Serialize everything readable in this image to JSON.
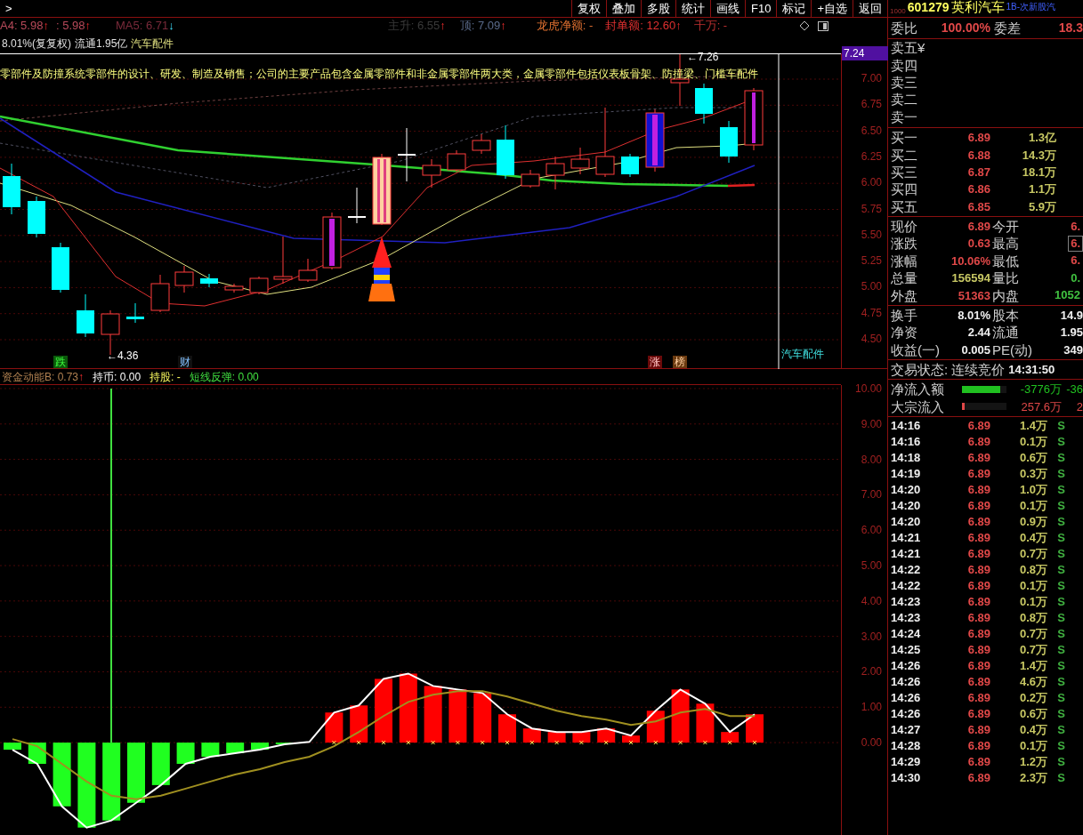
{
  "toolbar": {
    "nav": ">",
    "buttons": [
      "复权",
      "叠加",
      "多股",
      "统计",
      "画线",
      "F10",
      "标记",
      "+自选",
      "返回"
    ]
  },
  "ma_line": [
    {
      "text": "A4: 5.98",
      "arrow": "↑",
      "falling": false,
      "color": "#b84a5a"
    },
    {
      "text": ": 5.98",
      "arrow": "↑",
      "falling": false,
      "color": "#b84a5a"
    },
    {
      "text": "MA5: 6.71",
      "arrow": "↓",
      "falling": true,
      "color": "#7a2a3a"
    },
    {
      "text": "主升: 6.55",
      "arrow": "↑",
      "falling": false,
      "color": "#3a3a3a"
    },
    {
      "text": "顶: 7.09",
      "arrow": "↑",
      "falling": false,
      "color": "#5a6a8a"
    },
    {
      "text": "龙虎净额: -",
      "color": "#e07030"
    },
    {
      "text": "封单额: 12.60",
      "arrow": "↑",
      "falling": false,
      "color": "#e03030"
    },
    {
      "text": "千万: -",
      "color": "#c03030"
    }
  ],
  "info_line": {
    "turnover": "8.01%(复复权)",
    "float": "流通1.95亿",
    "sector": "汽车配件"
  },
  "main_chart": {
    "crosshair_price": "7.24",
    "high_label": "←7.26",
    "low_label": "←4.36",
    "description": "零部件及防撞系统零部件的设计、研发、制造及销售；公司的主要产品包含金属零部件和非金属零部件两大类，金属零部件包括仪表板骨架、防撞梁、门槛车配件",
    "yticks": [
      "7.00",
      "6.75",
      "6.50",
      "6.25",
      "6.00",
      "5.75",
      "5.50",
      "5.25",
      "5.00",
      "4.75",
      "4.50"
    ],
    "markers": [
      {
        "text": "跌",
        "kind": "down"
      },
      {
        "text": "财",
        "kind": "finance"
      },
      {
        "text": "涨",
        "kind": "up"
      },
      {
        "text": "榜",
        "kind": "list"
      }
    ],
    "sector_label": "汽车配件"
  },
  "indicator": {
    "labels": [
      {
        "text": ": 0.73",
        "arrow": "↑",
        "kind": "main"
      },
      {
        "text": "持币: 0.00",
        "kind": "cash"
      },
      {
        "text": "持股: -",
        "kind": "stock"
      },
      {
        "text": "短线反弹: 0.00",
        "kind": "rebound"
      }
    ],
    "chart_data": {
      "type": "bar",
      "stacked": true,
      "grid": true,
      "ylim": [
        -2.61,
        10.1
      ],
      "categories": [
        null,
        null,
        null,
        null,
        null,
        null,
        null,
        null,
        null,
        null,
        null,
        null,
        null,
        null,
        null,
        null,
        null,
        null,
        null,
        null,
        null,
        null,
        null,
        null,
        null,
        null,
        null,
        null,
        null,
        null,
        null
      ],
      "yticks": [
        {
          "value": 10,
          "label": "10.00"
        },
        {
          "value": 9,
          "label": "9.00"
        },
        {
          "value": 8,
          "label": "8.00"
        },
        {
          "value": 7,
          "label": "7.00"
        },
        {
          "value": 6,
          "label": "6.00"
        },
        {
          "value": 5,
          "label": "5.00"
        },
        {
          "value": 4,
          "label": "4.00"
        },
        {
          "value": 3,
          "label": "3.00"
        },
        {
          "value": 2,
          "label": "2.00"
        },
        {
          "value": 1,
          "label": "1.00"
        },
        {
          "value": 0,
          "label": "0.00"
        }
      ],
      "series": [
        {
          "name": "资金动能B",
          "type": "bar",
          "color": "#ff0000",
          "values": [
            null,
            null,
            null,
            null,
            null,
            null,
            null,
            null,
            null,
            null,
            null,
            null,
            null,
            0.85,
            1.05,
            1.8,
            1.95,
            1.6,
            1.5,
            1.4,
            0.8,
            0.4,
            0.3,
            0.3,
            0.4,
            0.2,
            0.9,
            1.5,
            1.1,
            0.3,
            0.8
          ]
        },
        {
          "type": "bar",
          "color": "#20ff20",
          "values": [
            -0.2,
            -0.6,
            -1.8,
            -2.4,
            -2.2,
            -1.7,
            -1.2,
            -0.6,
            -0.4,
            -0.3,
            -0.2,
            -0.05,
            null,
            null,
            null,
            null,
            null,
            null,
            null,
            null,
            null,
            null,
            null,
            null,
            null,
            null,
            null,
            null,
            null,
            null,
            null
          ]
        },
        {
          "type": "scatter",
          "color": "#ffff60",
          "values": [
            null,
            null,
            null,
            null,
            null,
            null,
            null,
            null,
            null,
            null,
            null,
            null,
            null,
            0,
            0,
            0,
            0,
            0,
            0,
            0,
            0,
            0,
            0,
            0,
            0,
            0,
            0,
            0,
            0,
            0,
            0
          ]
        },
        {
          "type": "line",
          "color": "#ffffff",
          "values": [
            -0.2,
            -0.6,
            -1.8,
            -2.4,
            -2.2,
            -1.7,
            -1.2,
            -0.6,
            -0.4,
            -0.3,
            -0.2,
            -0.05,
            0.02,
            0.85,
            1.05,
            1.8,
            1.95,
            1.6,
            1.5,
            1.4,
            0.8,
            0.4,
            0.3,
            0.3,
            0.4,
            0.2,
            0.9,
            1.5,
            1.1,
            0.3,
            0.8
          ]
        },
        {
          "type": "line",
          "color": "#a09020",
          "values": [
            0.1,
            -0.1,
            -0.6,
            -1.1,
            -1.5,
            -1.6,
            -1.5,
            -1.3,
            -1.1,
            -0.9,
            -0.75,
            -0.55,
            -0.4,
            -0.1,
            0.3,
            0.75,
            1.15,
            1.35,
            1.45,
            1.45,
            1.3,
            1.1,
            0.9,
            0.75,
            0.65,
            0.5,
            0.6,
            0.85,
            0.95,
            0.75,
            0.75
          ]
        }
      ]
    }
  },
  "quote_panel": {
    "code_prefix": "1000",
    "code": "601279",
    "name": "英利汽车",
    "tag": "1B-次新股汽",
    "ratio": {
      "label": "委比",
      "value": "100.00%",
      "label2": "委差",
      "value2": "18.3"
    },
    "asks": [
      {
        "label": "卖五",
        "extra": "¥"
      },
      {
        "label": "卖四"
      },
      {
        "label": "卖三"
      },
      {
        "label": "卖二"
      },
      {
        "label": "卖一"
      }
    ],
    "bids": [
      {
        "label": "买一",
        "price": "6.89",
        "volume": "1.3亿"
      },
      {
        "label": "买二",
        "price": "6.88",
        "volume": "14.3万"
      },
      {
        "label": "买三",
        "price": "6.87",
        "volume": "18.1万"
      },
      {
        "label": "买四",
        "price": "6.86",
        "volume": "1.1万"
      },
      {
        "label": "买五",
        "price": "6.85",
        "volume": "5.9万"
      }
    ],
    "stats": [
      {
        "left": {
          "label": "现价",
          "value": "6.89",
          "color": "#e04848"
        },
        "right": {
          "label": "今开",
          "value": "6.",
          "color": "#e04848",
          "highlighted": false
        }
      },
      {
        "left": {
          "label": "涨跌",
          "value": "0.63",
          "color": "#e04848"
        },
        "right": {
          "label": "最高",
          "value": "6.",
          "color": "#e04848",
          "highlighted": true
        }
      },
      {
        "left": {
          "label": "涨幅",
          "value": "10.06%",
          "color": "#e04848"
        },
        "right": {
          "label": "最低",
          "value": "6.",
          "color": "#e04848",
          "highlighted": false
        }
      },
      {
        "left": {
          "label": "总量",
          "value": "156594",
          "color": "#c8c864"
        },
        "right": {
          "label": "量比",
          "value": "0.",
          "color": "#40c040",
          "highlighted": false
        }
      },
      {
        "left": {
          "label": "外盘",
          "value": "51363",
          "color": "#e04848"
        },
        "right": {
          "label": "内盘",
          "value": "1052",
          "color": "#40c040",
          "highlighted": false
        }
      }
    ],
    "fundamentals": [
      {
        "label": "换手",
        "value": "8.01%",
        "label2": "股本",
        "value2": "14.9"
      },
      {
        "label": "净资",
        "value": "2.44",
        "label2": "流通",
        "value2": "1.95"
      },
      {
        "label": "收益(一)",
        "value": "0.005",
        "label2": "PE(动)",
        "value2": "349"
      }
    ],
    "trade_status": {
      "label": "交易状态:",
      "value": "连续竞价",
      "time": "14:31:50"
    },
    "flows": [
      {
        "label": "净流入额",
        "level": 0.85,
        "color": "#20c020",
        "value": "-3776万",
        "value2": "-36"
      },
      {
        "label": "大宗流入",
        "level": 0.06,
        "color": "#e04848",
        "value": "257.6万",
        "value2": "2"
      }
    ],
    "ticks": [
      {
        "time": "14:16",
        "price": "6.89",
        "volume": "1.4万",
        "side": "S"
      },
      {
        "time": "14:16",
        "price": "6.89",
        "volume": "0.1万",
        "side": "S"
      },
      {
        "time": "14:18",
        "price": "6.89",
        "volume": "0.6万",
        "side": "S"
      },
      {
        "time": "14:19",
        "price": "6.89",
        "volume": "0.3万",
        "side": "S"
      },
      {
        "time": "14:20",
        "price": "6.89",
        "volume": "1.0万",
        "side": "S"
      },
      {
        "time": "14:20",
        "price": "6.89",
        "volume": "0.1万",
        "side": "S"
      },
      {
        "time": "14:20",
        "price": "6.89",
        "volume": "0.9万",
        "side": "S"
      },
      {
        "time": "14:21",
        "price": "6.89",
        "volume": "0.4万",
        "side": "S"
      },
      {
        "time": "14:21",
        "price": "6.89",
        "volume": "0.7万",
        "side": "S"
      },
      {
        "time": "14:22",
        "price": "6.89",
        "volume": "0.8万",
        "side": "S"
      },
      {
        "time": "14:22",
        "price": "6.89",
        "volume": "0.1万",
        "side": "S"
      },
      {
        "time": "14:23",
        "price": "6.89",
        "volume": "0.1万",
        "side": "S"
      },
      {
        "time": "14:23",
        "price": "6.89",
        "volume": "0.8万",
        "side": "S"
      },
      {
        "time": "14:24",
        "price": "6.89",
        "volume": "0.7万",
        "side": "S"
      },
      {
        "time": "14:25",
        "price": "6.89",
        "volume": "0.7万",
        "side": "S"
      },
      {
        "time": "14:26",
        "price": "6.89",
        "volume": "1.4万",
        "side": "S"
      },
      {
        "time": "14:26",
        "price": "6.89",
        "volume": "4.6万",
        "side": "S"
      },
      {
        "time": "14:26",
        "price": "6.89",
        "volume": "0.2万",
        "side": "S"
      },
      {
        "time": "14:26",
        "price": "6.89",
        "volume": "0.6万",
        "side": "S"
      },
      {
        "time": "14:27",
        "price": "6.89",
        "volume": "0.4万",
        "side": "S"
      },
      {
        "time": "14:28",
        "price": "6.89",
        "volume": "0.1万",
        "side": "S"
      },
      {
        "time": "14:29",
        "price": "6.89",
        "volume": "1.2万",
        "side": "S"
      },
      {
        "time": "14:30",
        "price": "6.89",
        "volume": "2.3万",
        "side": "S"
      }
    ]
  }
}
